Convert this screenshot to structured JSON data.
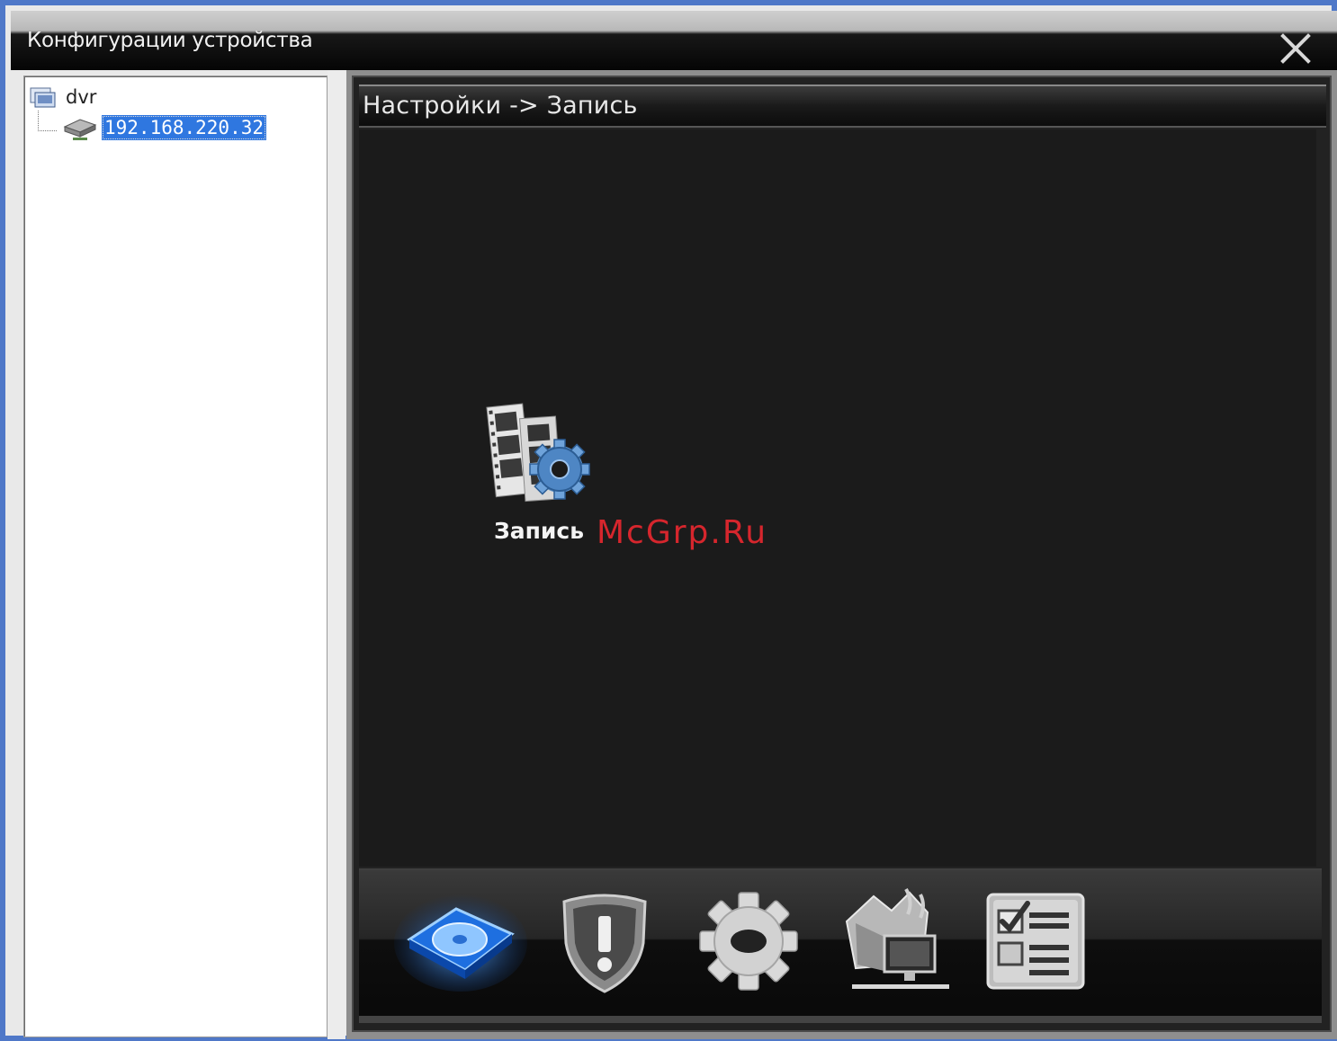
{
  "window": {
    "title": "Конфигурации устройства"
  },
  "tree": {
    "root_label": "dvr",
    "child_label": "192.168.220.32"
  },
  "main": {
    "breadcrumb": "Настройки -> Запись",
    "tile_label": "Запись",
    "watermark": "McGrp.Ru"
  },
  "dock": {
    "items": [
      {
        "icon": "storage-disk-icon"
      },
      {
        "icon": "alarm-shield-icon"
      },
      {
        "icon": "system-gear-icon"
      },
      {
        "icon": "network-tools-icon"
      },
      {
        "icon": "checklist-icon"
      }
    ]
  },
  "colors": {
    "frame": "#4f78c8",
    "selection": "#2f77e0",
    "watermark": "#d6262d"
  }
}
